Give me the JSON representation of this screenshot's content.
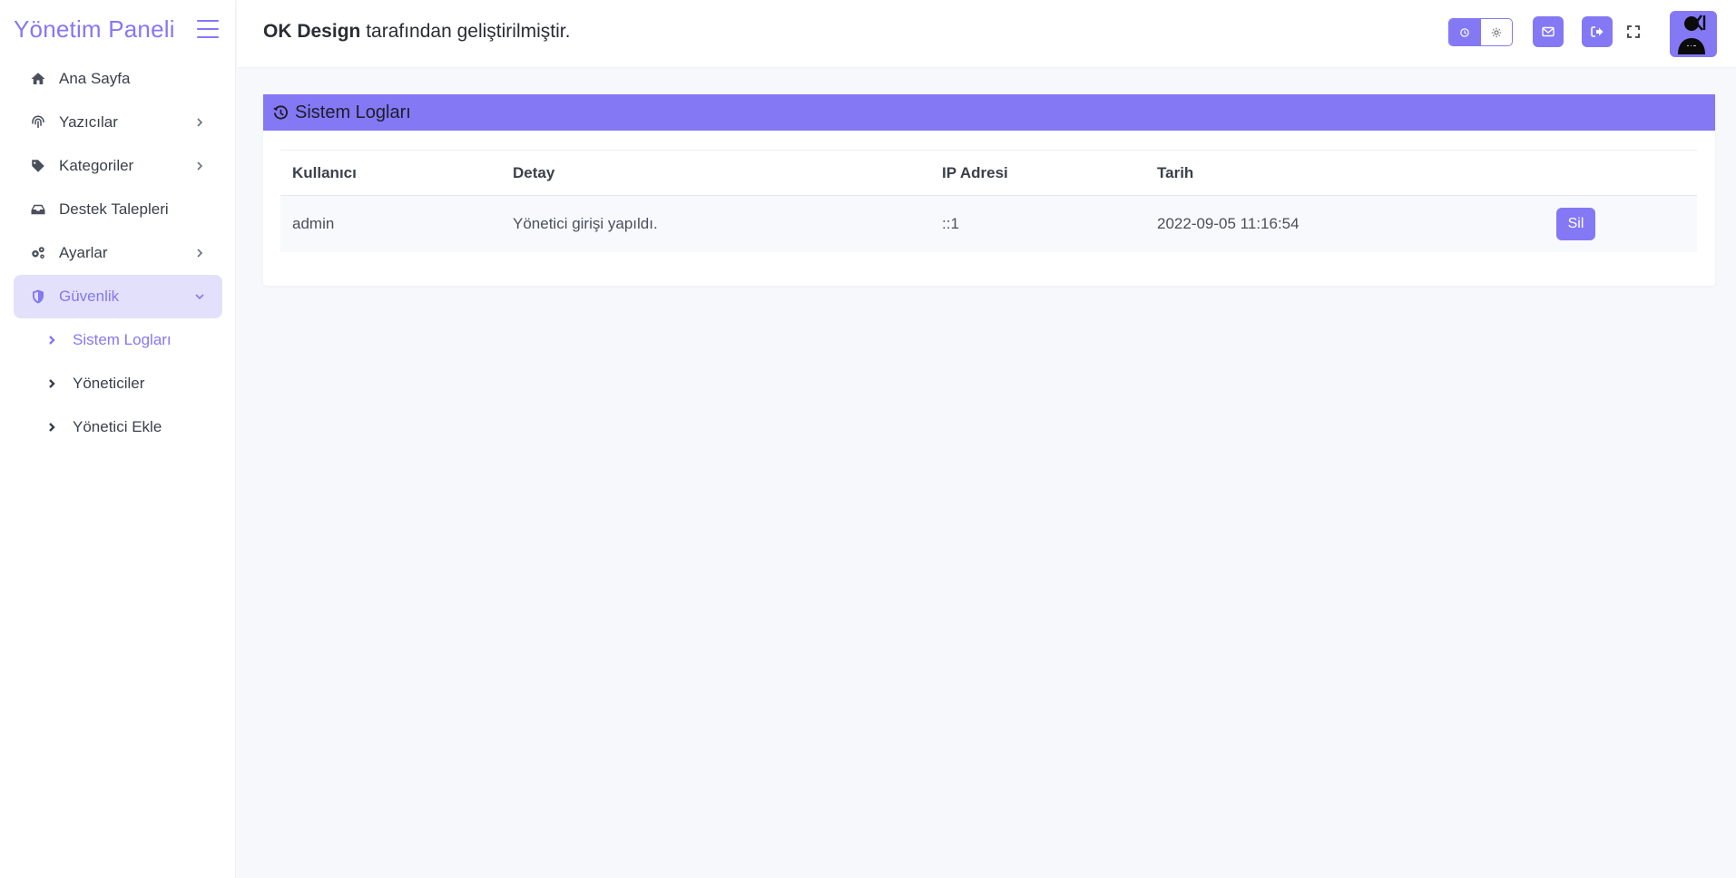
{
  "brand": {
    "title": "Yönetim Paneli"
  },
  "sidebar": {
    "items": [
      {
        "label": "Ana Sayfa",
        "icon": "home-icon"
      },
      {
        "label": "Yazıcılar",
        "icon": "fingerprint-icon"
      },
      {
        "label": "Kategoriler",
        "icon": "tag-icon"
      },
      {
        "label": "Destek Talepleri",
        "icon": "inbox-icon"
      },
      {
        "label": "Ayarlar",
        "icon": "gears-icon"
      },
      {
        "label": "Güvenlik",
        "icon": "shield-icon",
        "active": true
      }
    ],
    "subitems": [
      {
        "label": "Sistem Logları",
        "active": true
      },
      {
        "label": "Yöneticiler"
      },
      {
        "label": "Yönetici Ekle"
      }
    ]
  },
  "header": {
    "brand_bold": "OK Design",
    "text": " tarafından geliştirilmiştir."
  },
  "card": {
    "title": "Sistem Logları",
    "columns": [
      "Kullanıcı",
      "Detay",
      "IP Adresi",
      "Tarih"
    ],
    "rows": [
      {
        "user": "admin",
        "detail": "Yönetici girişi yapıldı.",
        "ip": "::1",
        "date": "2022-09-05 11:16:54",
        "action": "Sil"
      }
    ]
  },
  "colors": {
    "accent": "#8478f4",
    "accent_light": "#e3e0fc",
    "background": "#f7f8fc"
  }
}
